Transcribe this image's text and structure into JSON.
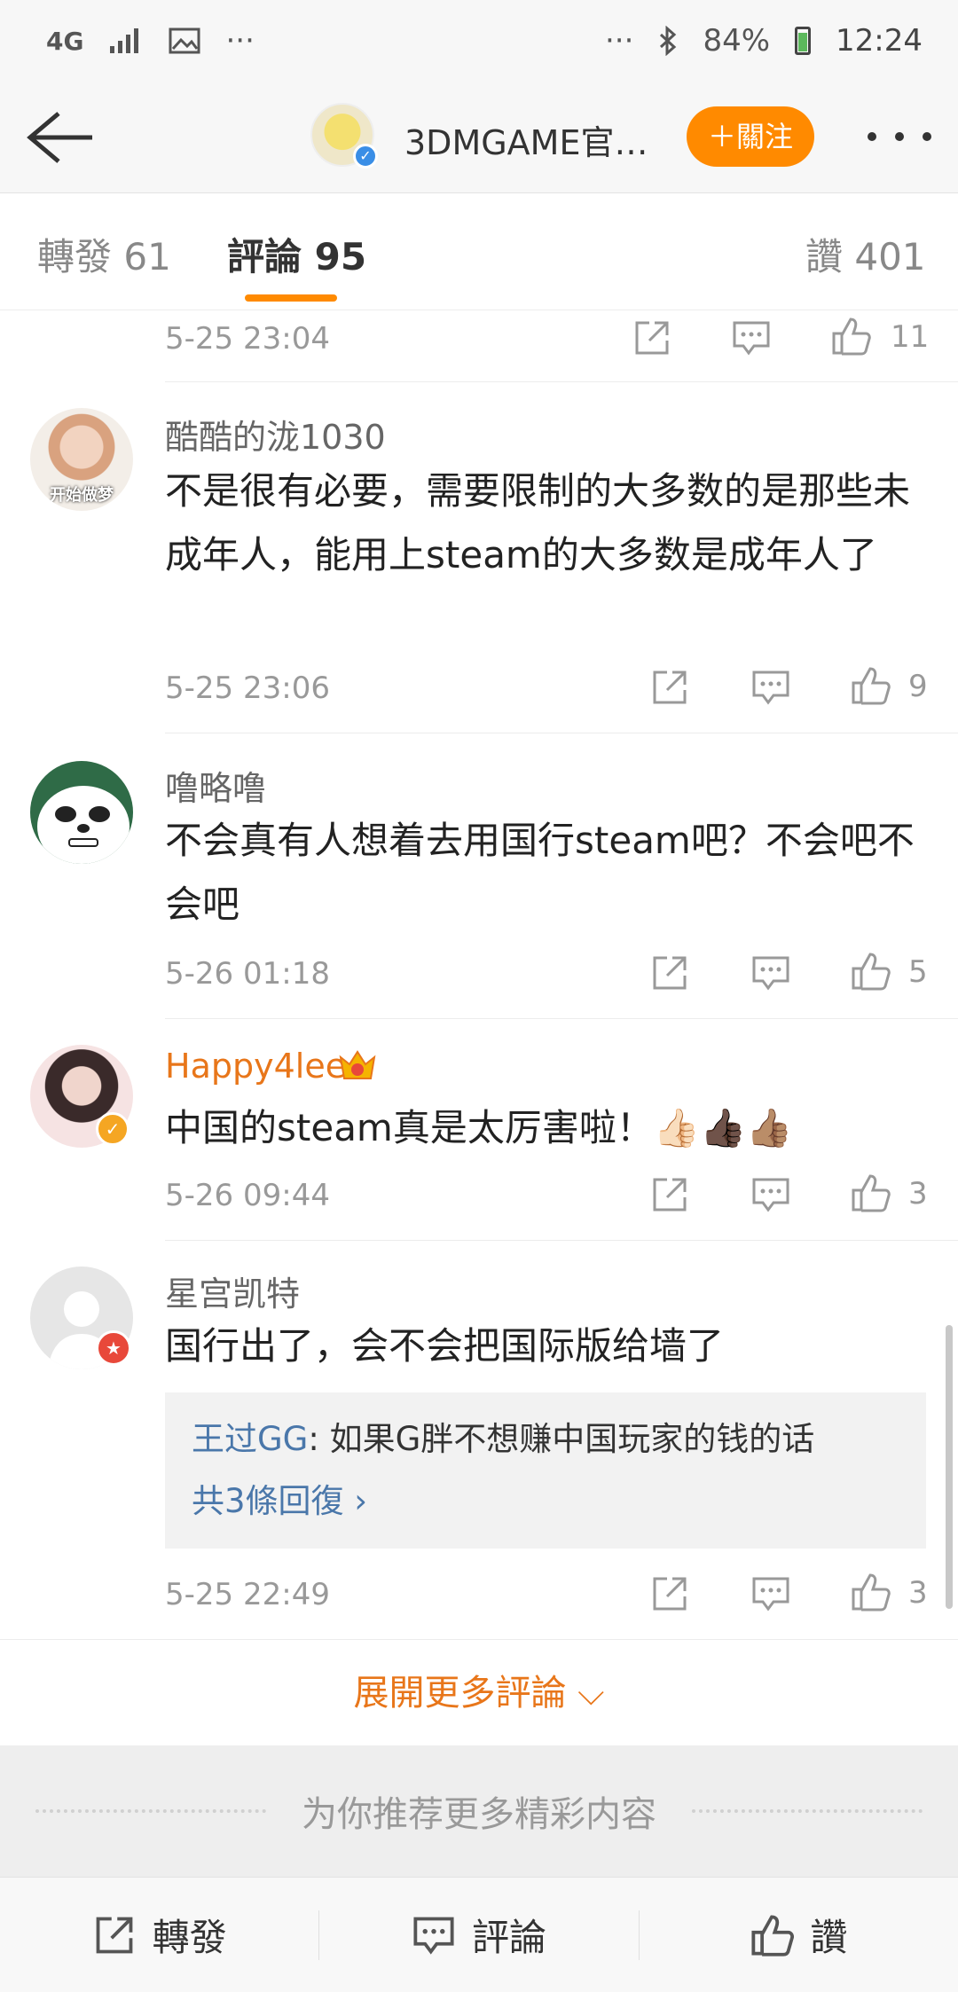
{
  "status_bar": {
    "network": "4G",
    "signal_icon": "signal-icon",
    "image_icon": "image-icon",
    "more_dots": "···",
    "right_dots": "···",
    "bluetooth_icon": "bluetooth-icon",
    "battery_percent": "84%",
    "time": "12:24"
  },
  "header": {
    "title": "3DMGAME官…",
    "follow_label": "＋關注"
  },
  "tabs": {
    "repost_label": "轉發 61",
    "comment_label": "評論 95",
    "like_label": "讚 401"
  },
  "comments": [
    {
      "time": "5-25 23:04",
      "likes": "11"
    },
    {
      "username": "酷酷的泷1030",
      "text": "不是很有必要，需要限制的大多数的是那些未成年人，能用上steam的大多数是成年人了",
      "time": "5-25 23:06",
      "likes": "9",
      "avatar_text": "开始做梦"
    },
    {
      "username": "噜略噜",
      "text": "不会真有人想着去用国行steam吧？不会吧不会吧",
      "time": "5-26 01:18",
      "likes": "5"
    },
    {
      "username": "Happy4lee",
      "text": "中国的steam真是太厉害啦！👍🏻👍🏿👍🏽",
      "time": "5-26 09:44",
      "likes": "3"
    },
    {
      "username": "星宫凯特",
      "text": "国行出了，会不会把国际版给墙了",
      "reply_user": "王过GG",
      "reply_text": ": 如果G胖不想赚中国玩家的钱的话",
      "reply_more": "共3條回復 ›",
      "time": "5-25 22:49",
      "likes": "3"
    }
  ],
  "load_more": "展開更多評論 ⌵",
  "recommend": "为你推荐更多精彩内容",
  "bottom_bar": {
    "repost": "轉發",
    "comment": "評論",
    "like": "讚"
  },
  "colors": {
    "accent": "#ff8a00",
    "vip_name": "#e8761a",
    "link": "#4a77aa"
  }
}
